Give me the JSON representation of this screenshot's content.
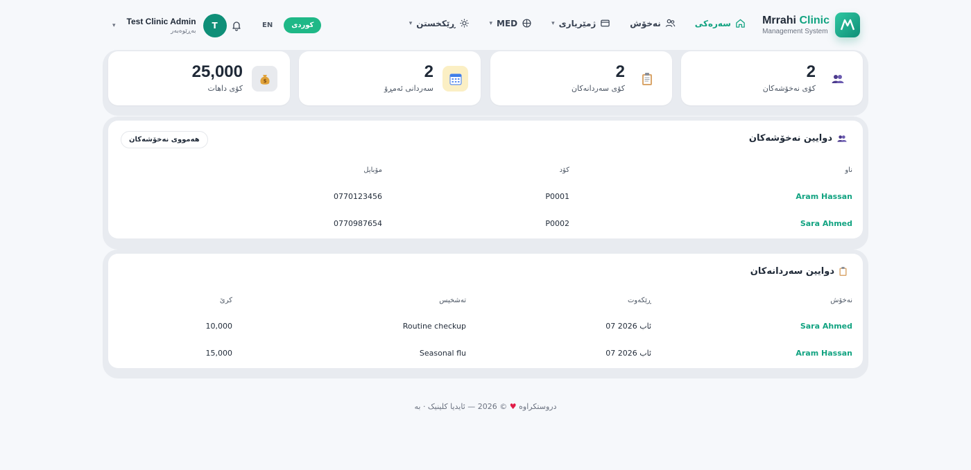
{
  "brand": {
    "name_part1": "Mrrahi",
    "name_part2": "Clinic",
    "subtitle": "Management System"
  },
  "nav": {
    "home": "سەرەکی",
    "patients": "نەخۆش",
    "accounting": "ژمێریاری",
    "med": "MED",
    "settings": "ڕێکخستن"
  },
  "header": {
    "lang_en": "EN",
    "lang_ku": "كوردی",
    "user_name": "Test Clinic Admin",
    "user_role": "بەڕێوەبەر",
    "avatar_initial": "T"
  },
  "stats": [
    {
      "value": "2",
      "label": "کۆی نەخۆشەکان",
      "icon": "users-icon"
    },
    {
      "value": "2",
      "label": "کۆی سەردانەکان",
      "icon": "clipboard-icon"
    },
    {
      "value": "2",
      "label": "سەردانی ئەمڕۆ",
      "icon": "calendar-icon"
    },
    {
      "value": "25,000",
      "label": "کۆی داهات",
      "icon": "money-bag-icon"
    }
  ],
  "recent_patients": {
    "title": "دوایین نەخۆشەکان",
    "all_button": "هەمووی نەخۆشەکان",
    "columns": {
      "name": "ناو",
      "code": "کۆد",
      "mobile": "مۆبایل"
    },
    "rows": [
      {
        "name": "Aram Hassan",
        "code": "P0001",
        "mobile": "0770123456"
      },
      {
        "name": "Sara Ahmed",
        "code": "P0002",
        "mobile": "0770987654"
      }
    ]
  },
  "recent_visits": {
    "title": "دوایین سەردانەکان",
    "columns": {
      "patient": "نەخۆش",
      "date": "ڕێکەوت",
      "diagnosis": "تەشخیس",
      "fee": "کرێ"
    },
    "rows": [
      {
        "patient": "Sara Ahmed",
        "date": "07 ئاب 2026",
        "diagnosis": "Routine checkup",
        "fee": "10,000"
      },
      {
        "patient": "Aram Hassan",
        "date": "07 ئاب 2026",
        "diagnosis": "Seasonal flu",
        "fee": "15,000"
      }
    ]
  },
  "footer": {
    "text_before": "© 2026 — ئایدیا کلینیک · بە",
    "text_after": "دروستکراوە"
  },
  "colors": {
    "accent": "#12a381",
    "accent_pill": "#1fb887",
    "avatar": "#0f8f78"
  }
}
